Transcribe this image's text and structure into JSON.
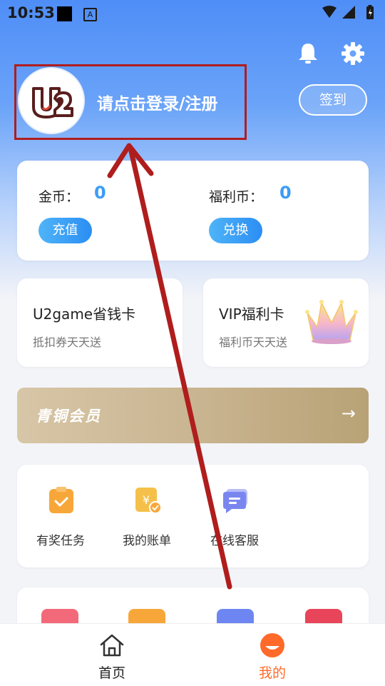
{
  "status_bar": {
    "time": "10:53",
    "badge_letter": "A"
  },
  "header": {
    "login_prompt": "请点击登录/注册",
    "signin_label": "签到",
    "avatar_logo_text": "U2"
  },
  "wallet": {
    "gold_label": "金币：",
    "gold_value": "0",
    "recharge_label": "充值",
    "bonus_label": "福利币：",
    "bonus_value": "0",
    "exchange_label": "兑换"
  },
  "promo_cards": [
    {
      "title": "U2game省钱卡",
      "subtitle": "抵扣券天天送"
    },
    {
      "title": "VIP福利卡",
      "subtitle": "福利币天天送"
    }
  ],
  "membership": {
    "label": "青铜会员"
  },
  "services": [
    {
      "label": "有奖任务",
      "icon": "clipboard-check-icon",
      "color": "#f7a73a"
    },
    {
      "label": "我的账单",
      "icon": "bill-icon",
      "color": "#f5c04a"
    },
    {
      "label": "在线客服",
      "icon": "chat-icon",
      "color": "#7a86f0"
    }
  ],
  "tabs": [
    {
      "label": "首页",
      "icon": "home-icon",
      "active": false
    },
    {
      "label": "我的",
      "icon": "profile-icon",
      "active": true
    }
  ],
  "colors": {
    "accent": "#3c9cf6",
    "active_tab": "#ff6a2a",
    "annotation_red": "#b01d1d"
  }
}
